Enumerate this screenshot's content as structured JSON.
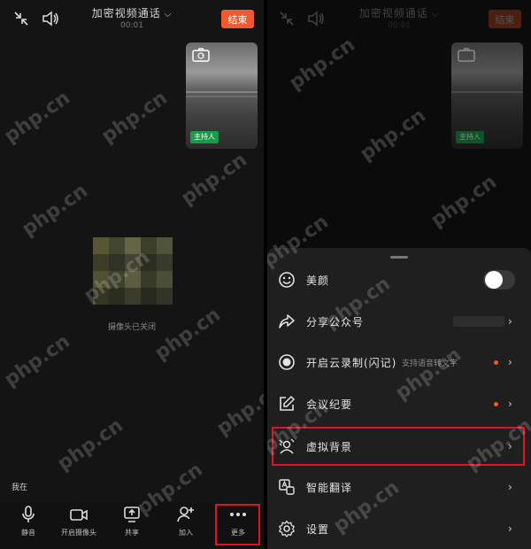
{
  "call": {
    "title": "加密视频通话",
    "subtitle": "00:01",
    "end_label": "结束",
    "host_tag": "主持人",
    "camera_off_text": "摄像头已关闭",
    "speaker_label": "我在"
  },
  "toolbar": [
    {
      "label": "静音",
      "icon": "mic-icon"
    },
    {
      "label": "开启摄像头",
      "icon": "video-camera-icon"
    },
    {
      "label": "共享",
      "icon": "share-screen-icon"
    },
    {
      "label": "加入",
      "icon": "add-person-icon"
    },
    {
      "label": "更多",
      "icon": "more-dots-icon"
    }
  ],
  "menu": {
    "items": [
      {
        "label": "美颜",
        "icon": "smiley-icon",
        "control": "toggle"
      },
      {
        "label": "分享公众号",
        "icon": "share-arrow-icon",
        "control": "chevron"
      },
      {
        "label": "开启云录制(闪记)",
        "icon": "record-icon",
        "sub": "支持语音转文字",
        "control": "chevron",
        "dot": true
      },
      {
        "label": "会议纪要",
        "icon": "edit-icon",
        "control": "chevron",
        "dot": true
      },
      {
        "label": "虚拟背景",
        "icon": "virtual-background-icon",
        "control": "chevron"
      },
      {
        "label": "智能翻译",
        "icon": "translate-icon",
        "control": "chevron"
      },
      {
        "label": "设置",
        "icon": "gear-icon",
        "control": "chevron"
      }
    ],
    "beauty_enabled": true
  },
  "watermark": "php.cn",
  "colors": {
    "accent": "#f0582d",
    "highlight": "#e0131f",
    "host_tag": "#1a9a4a"
  }
}
